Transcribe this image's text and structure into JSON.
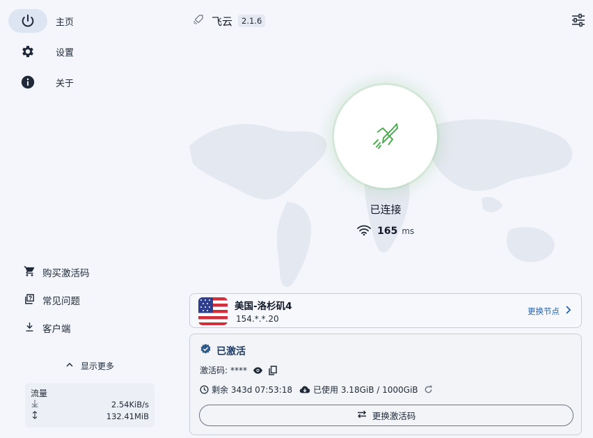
{
  "nav": {
    "items": [
      {
        "label": "主页",
        "icon": "power-icon",
        "active": true
      },
      {
        "label": "设置",
        "icon": "gear-icon",
        "active": false
      },
      {
        "label": "关于",
        "icon": "info-icon",
        "active": false
      }
    ]
  },
  "sidebar_links": [
    {
      "label": "购买激活码",
      "icon": "cart-icon"
    },
    {
      "label": "常见问题",
      "icon": "help-icon"
    },
    {
      "label": "客户端",
      "icon": "download-icon"
    }
  ],
  "show_more_label": "显示更多",
  "traffic": {
    "title": "流量",
    "speed": "2.54KiB/s",
    "total": "132.41MiB"
  },
  "header": {
    "app_name": "飞云",
    "version": "2.1.6"
  },
  "connection": {
    "status": "已连接",
    "latency_value": "165",
    "latency_unit": "ms",
    "accent_color": "#4caf50"
  },
  "node": {
    "name": "美国-洛杉矶4",
    "ip": "154.*.*.20",
    "switch_label": "更换节点",
    "flag": "us-flag"
  },
  "activation": {
    "status": "已激活",
    "code_label": "激活码:",
    "code_masked": "****",
    "remaining": "剩余 343d 07:53:18",
    "used": "已使用 3.18GiB / 1000GiB",
    "change_label": "更换激活码"
  }
}
